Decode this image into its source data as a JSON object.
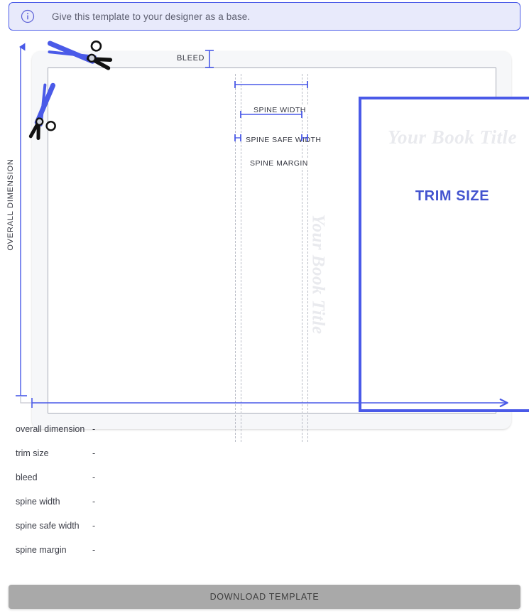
{
  "banner": {
    "icon": "info-circle-icon",
    "message": "Give this template to your designer as a base."
  },
  "diagram": {
    "bleed_label": "BLEED",
    "overall_dimension_label": "OVERALL DIMENSION",
    "spine_width_label": "SPINE WIDTH",
    "spine_safe_width_label": "SPINE SAFE WIDTH",
    "spine_margin_label": "SPINE MARGIN",
    "trim_size_label": "TRIM SIZE",
    "cover_placeholder_title": "Your Book Title",
    "spine_placeholder_title": "Your Book Title",
    "scissors_icon_top": "scissors-icon",
    "scissors_icon_left": "scissors-icon",
    "accent_color": "#4a5ae8",
    "placeholder_text_color": "#e9eaee",
    "guide_color": "#b9bcc6"
  },
  "measures": {
    "rows": [
      {
        "label": "overall dimension",
        "value": "-"
      },
      {
        "label": "trim size",
        "value": "-"
      },
      {
        "label": "bleed",
        "value": "-"
      },
      {
        "label": "spine width",
        "value": "-"
      },
      {
        "label": "spine safe width",
        "value": "-"
      },
      {
        "label": "spine margin",
        "value": "-"
      }
    ]
  },
  "footer": {
    "download_label": "DOWNLOAD TEMPLATE",
    "download_disabled": true
  }
}
